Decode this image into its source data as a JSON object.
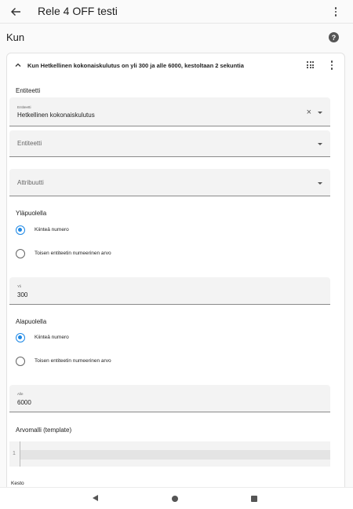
{
  "topbar": {
    "title": "Rele 4 OFF testi",
    "back_icon": "arrow-left-icon",
    "menu_icon": "more-vertical-icon"
  },
  "section": {
    "title": "Kun",
    "help_icon": "help-circle-icon",
    "help_glyph": "?"
  },
  "condition": {
    "summary": "Kun Hetkellinen kokonaiskulutus on yli 300 ja alle 6000, kestoltaan 2 sekuntia",
    "entity_label": "Entiteetti",
    "entity_field": {
      "small_label": "Entiteetti",
      "value": "Hetkellinen kokonaiskulutus",
      "clear_glyph": "×"
    },
    "entity2_placeholder": "Entiteetti",
    "attribute_placeholder": "Attribuutti",
    "above": {
      "label": "Yläpuolella",
      "option_fixed": "Kiinteä numero",
      "option_entity": "Toisen entiteetin numeerinen arvo",
      "selected": "Kiinteä numero",
      "field_small": "Yli",
      "field_value": "300"
    },
    "below": {
      "label": "Alapuolella",
      "option_fixed": "Kiinteä numero",
      "option_entity": "Toisen entiteetin numeerinen arvo",
      "selected": "Kiinteä numero",
      "field_small": "Alle",
      "field_value": "6000"
    },
    "template_label": "Arvomalli (template)",
    "template_line_number": "1",
    "duration_label": "Kesto"
  },
  "navbar": {
    "back_icon": "nav-back-icon",
    "home_icon": "nav-home-icon",
    "recents_icon": "nav-recents-icon"
  },
  "colors": {
    "accent": "#1e88e5",
    "field_bg": "#f3f3f3",
    "page_bg": "#fafafa"
  }
}
